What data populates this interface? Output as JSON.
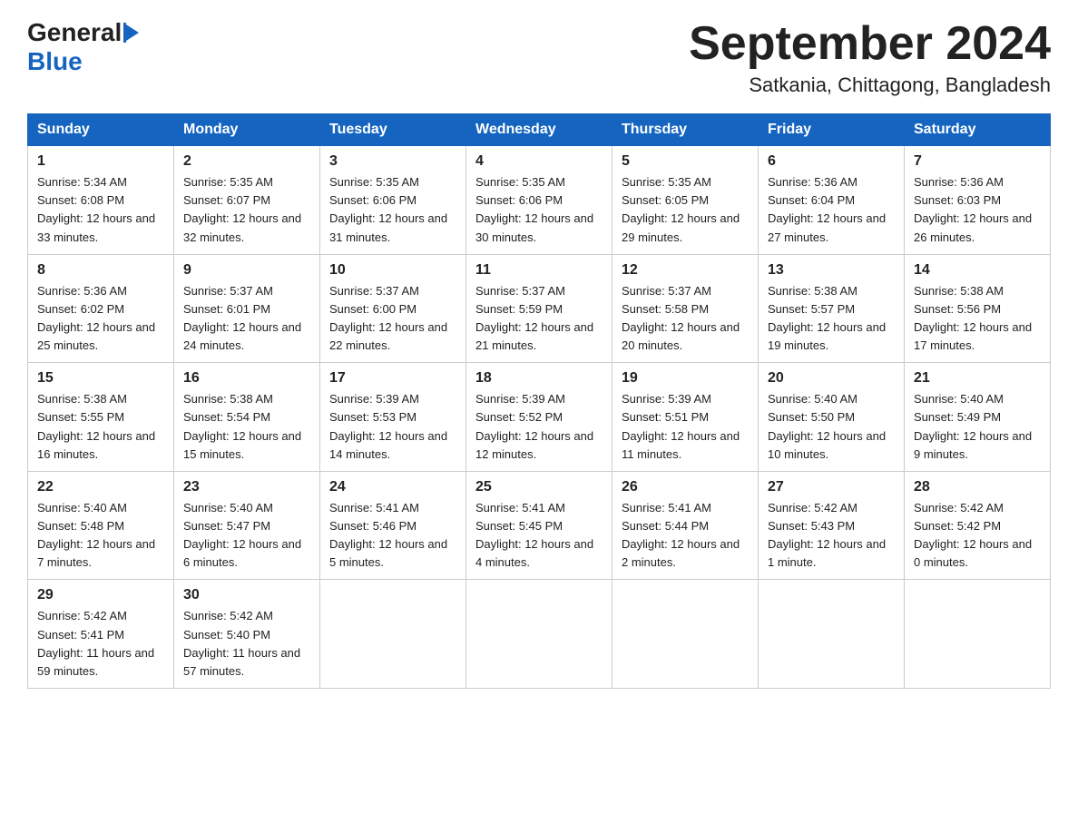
{
  "header": {
    "title": "September 2024",
    "subtitle": "Satkania, Chittagong, Bangladesh",
    "logo_general": "General",
    "logo_blue": "Blue"
  },
  "days_of_week": [
    "Sunday",
    "Monday",
    "Tuesday",
    "Wednesday",
    "Thursday",
    "Friday",
    "Saturday"
  ],
  "weeks": [
    [
      {
        "day": "1",
        "sunrise": "Sunrise: 5:34 AM",
        "sunset": "Sunset: 6:08 PM",
        "daylight": "Daylight: 12 hours and 33 minutes."
      },
      {
        "day": "2",
        "sunrise": "Sunrise: 5:35 AM",
        "sunset": "Sunset: 6:07 PM",
        "daylight": "Daylight: 12 hours and 32 minutes."
      },
      {
        "day": "3",
        "sunrise": "Sunrise: 5:35 AM",
        "sunset": "Sunset: 6:06 PM",
        "daylight": "Daylight: 12 hours and 31 minutes."
      },
      {
        "day": "4",
        "sunrise": "Sunrise: 5:35 AM",
        "sunset": "Sunset: 6:06 PM",
        "daylight": "Daylight: 12 hours and 30 minutes."
      },
      {
        "day": "5",
        "sunrise": "Sunrise: 5:35 AM",
        "sunset": "Sunset: 6:05 PM",
        "daylight": "Daylight: 12 hours and 29 minutes."
      },
      {
        "day": "6",
        "sunrise": "Sunrise: 5:36 AM",
        "sunset": "Sunset: 6:04 PM",
        "daylight": "Daylight: 12 hours and 27 minutes."
      },
      {
        "day": "7",
        "sunrise": "Sunrise: 5:36 AM",
        "sunset": "Sunset: 6:03 PM",
        "daylight": "Daylight: 12 hours and 26 minutes."
      }
    ],
    [
      {
        "day": "8",
        "sunrise": "Sunrise: 5:36 AM",
        "sunset": "Sunset: 6:02 PM",
        "daylight": "Daylight: 12 hours and 25 minutes."
      },
      {
        "day": "9",
        "sunrise": "Sunrise: 5:37 AM",
        "sunset": "Sunset: 6:01 PM",
        "daylight": "Daylight: 12 hours and 24 minutes."
      },
      {
        "day": "10",
        "sunrise": "Sunrise: 5:37 AM",
        "sunset": "Sunset: 6:00 PM",
        "daylight": "Daylight: 12 hours and 22 minutes."
      },
      {
        "day": "11",
        "sunrise": "Sunrise: 5:37 AM",
        "sunset": "Sunset: 5:59 PM",
        "daylight": "Daylight: 12 hours and 21 minutes."
      },
      {
        "day": "12",
        "sunrise": "Sunrise: 5:37 AM",
        "sunset": "Sunset: 5:58 PM",
        "daylight": "Daylight: 12 hours and 20 minutes."
      },
      {
        "day": "13",
        "sunrise": "Sunrise: 5:38 AM",
        "sunset": "Sunset: 5:57 PM",
        "daylight": "Daylight: 12 hours and 19 minutes."
      },
      {
        "day": "14",
        "sunrise": "Sunrise: 5:38 AM",
        "sunset": "Sunset: 5:56 PM",
        "daylight": "Daylight: 12 hours and 17 minutes."
      }
    ],
    [
      {
        "day": "15",
        "sunrise": "Sunrise: 5:38 AM",
        "sunset": "Sunset: 5:55 PM",
        "daylight": "Daylight: 12 hours and 16 minutes."
      },
      {
        "day": "16",
        "sunrise": "Sunrise: 5:38 AM",
        "sunset": "Sunset: 5:54 PM",
        "daylight": "Daylight: 12 hours and 15 minutes."
      },
      {
        "day": "17",
        "sunrise": "Sunrise: 5:39 AM",
        "sunset": "Sunset: 5:53 PM",
        "daylight": "Daylight: 12 hours and 14 minutes."
      },
      {
        "day": "18",
        "sunrise": "Sunrise: 5:39 AM",
        "sunset": "Sunset: 5:52 PM",
        "daylight": "Daylight: 12 hours and 12 minutes."
      },
      {
        "day": "19",
        "sunrise": "Sunrise: 5:39 AM",
        "sunset": "Sunset: 5:51 PM",
        "daylight": "Daylight: 12 hours and 11 minutes."
      },
      {
        "day": "20",
        "sunrise": "Sunrise: 5:40 AM",
        "sunset": "Sunset: 5:50 PM",
        "daylight": "Daylight: 12 hours and 10 minutes."
      },
      {
        "day": "21",
        "sunrise": "Sunrise: 5:40 AM",
        "sunset": "Sunset: 5:49 PM",
        "daylight": "Daylight: 12 hours and 9 minutes."
      }
    ],
    [
      {
        "day": "22",
        "sunrise": "Sunrise: 5:40 AM",
        "sunset": "Sunset: 5:48 PM",
        "daylight": "Daylight: 12 hours and 7 minutes."
      },
      {
        "day": "23",
        "sunrise": "Sunrise: 5:40 AM",
        "sunset": "Sunset: 5:47 PM",
        "daylight": "Daylight: 12 hours and 6 minutes."
      },
      {
        "day": "24",
        "sunrise": "Sunrise: 5:41 AM",
        "sunset": "Sunset: 5:46 PM",
        "daylight": "Daylight: 12 hours and 5 minutes."
      },
      {
        "day": "25",
        "sunrise": "Sunrise: 5:41 AM",
        "sunset": "Sunset: 5:45 PM",
        "daylight": "Daylight: 12 hours and 4 minutes."
      },
      {
        "day": "26",
        "sunrise": "Sunrise: 5:41 AM",
        "sunset": "Sunset: 5:44 PM",
        "daylight": "Daylight: 12 hours and 2 minutes."
      },
      {
        "day": "27",
        "sunrise": "Sunrise: 5:42 AM",
        "sunset": "Sunset: 5:43 PM",
        "daylight": "Daylight: 12 hours and 1 minute."
      },
      {
        "day": "28",
        "sunrise": "Sunrise: 5:42 AM",
        "sunset": "Sunset: 5:42 PM",
        "daylight": "Daylight: 12 hours and 0 minutes."
      }
    ],
    [
      {
        "day": "29",
        "sunrise": "Sunrise: 5:42 AM",
        "sunset": "Sunset: 5:41 PM",
        "daylight": "Daylight: 11 hours and 59 minutes."
      },
      {
        "day": "30",
        "sunrise": "Sunrise: 5:42 AM",
        "sunset": "Sunset: 5:40 PM",
        "daylight": "Daylight: 11 hours and 57 minutes."
      },
      null,
      null,
      null,
      null,
      null
    ]
  ]
}
